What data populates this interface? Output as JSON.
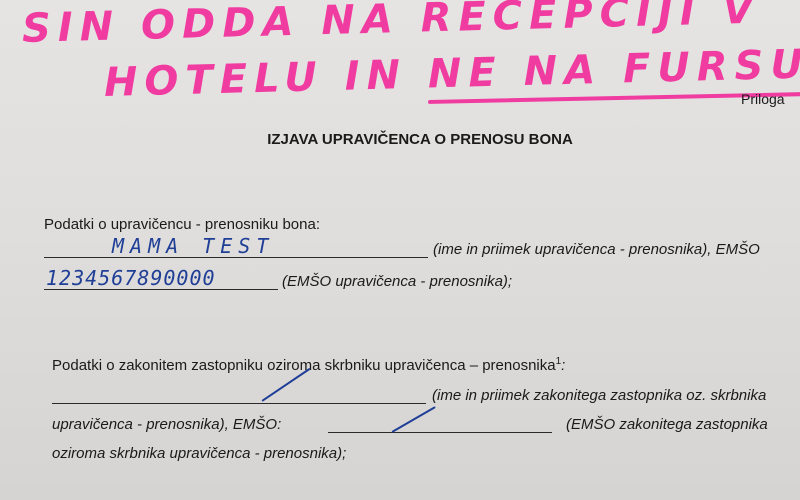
{
  "handwritten_note": {
    "line1": "SIN ODDA NA RECEPCIJI V",
    "line2": "HOTELU IN NE NA FURSU"
  },
  "document": {
    "attachment_label": "Priloga",
    "title": "IZJAVA UPRAVIČENCA O PRENOSU BONA",
    "beneficiary": {
      "heading": "Podatki o upravičencu - prenosniku bona:",
      "name_value": "MAMA TEST",
      "name_label": "(ime in priimek upravičenca - prenosnika), EMŠO",
      "emso_value": "1234567890000",
      "emso_label": "(EMŠO upravičenca - prenosnika);"
    },
    "representative": {
      "heading": "Podatki o zakonitem zastopniku oziroma skrbniku upravičenca – prenosnika",
      "footnote_mark": "1",
      "heading_suffix": ":",
      "name_label": "(ime in priimek zakonitega zastopnika oz. skrbnika",
      "line2_prefix": "upravičenca - prenosnika), EMŠO:",
      "emso_label": "(EMŠO zakonitega zastopnika",
      "line3": "oziroma skrbnika upravičenca - prenosnika);"
    }
  }
}
